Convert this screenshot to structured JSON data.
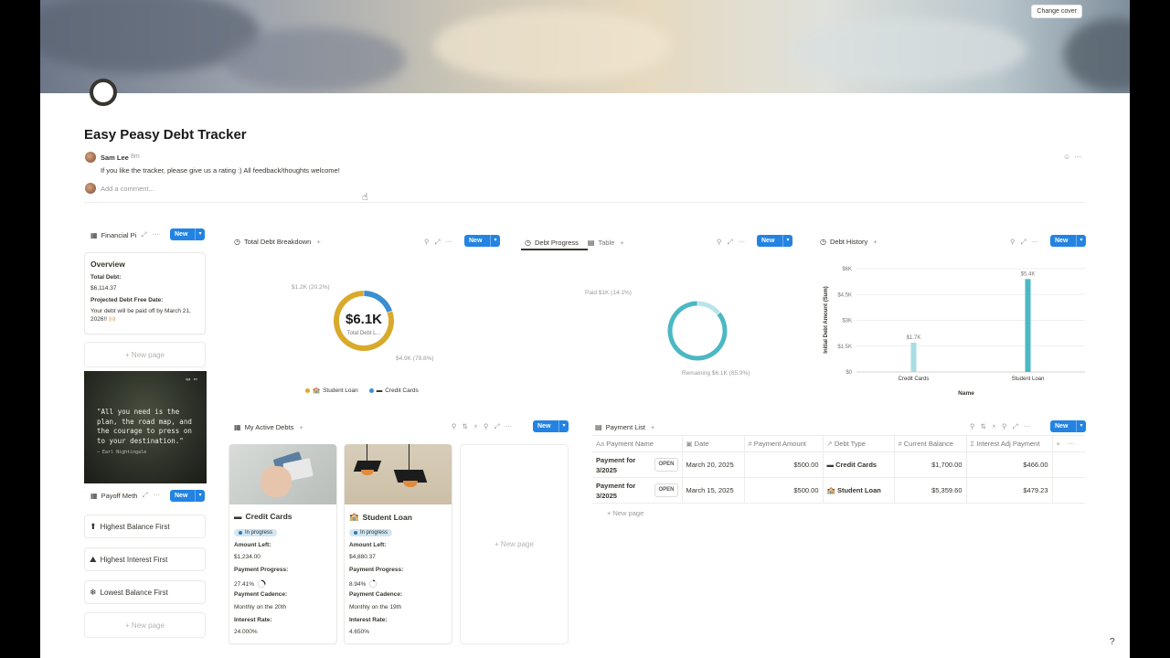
{
  "cover": {
    "change_label": "Change cover"
  },
  "page": {
    "title": "Easy Peasy Debt Tracker"
  },
  "comment": {
    "author": "Sam Lee",
    "time": "8m",
    "text": "If you like the tracker, please give us a rating :) All feedback/thoughts welcome!",
    "add_placeholder": "Add a comment..."
  },
  "financial": {
    "view_label": "Financial Pi",
    "new_label": "New",
    "overview_title": "Overview",
    "total_debt_label": "Total Debt:",
    "total_debt_value": "$6,114.37",
    "free_date_label": "Projected Debt Free Date:",
    "free_date_text": "Your debt will be paid off by March 21, 2026!! 🙌🏻",
    "new_page": "+ New page"
  },
  "quote": {
    "text": "\"All you need is the plan, the road map, and the courage to press on to your destination.\"",
    "author": "— Earl Nightingale"
  },
  "payoff": {
    "view_label": "Payoff Meth",
    "new_label": "New",
    "methods": [
      {
        "icon": "arrow-up-circle-icon",
        "glyph": "⬆",
        "label": "Highest Balance First"
      },
      {
        "icon": "mountain-icon",
        "glyph": "⛰",
        "label": "Highest Interest First"
      },
      {
        "icon": "snowflake-icon",
        "glyph": "❄",
        "label": "Lowest Balance First"
      }
    ],
    "new_page": "+ New page"
  },
  "breakdown": {
    "view_label": "Total Debt Breakdown",
    "new_label": "New",
    "center_value": "$6.1K",
    "center_label": "Total Debt L...",
    "legend": [
      "Student Loan",
      "Credit Cards"
    ],
    "colors": {
      "student_loan": "#d9a92a",
      "credit_cards": "#3b8ed0"
    }
  },
  "progress": {
    "tab_active": "Debt Progress",
    "tab_other": "Table",
    "new_label": "New",
    "colors": {
      "paid": "#b9e4e9",
      "remaining": "#4bb8c4"
    }
  },
  "history": {
    "view_label": "Debt History",
    "new_label": "New",
    "bar_color": "#4bb8c4"
  },
  "chart_data": [
    {
      "type": "pie",
      "title": "Total Debt Breakdown",
      "categories": [
        "Credit Cards",
        "Student Loan"
      ],
      "values": [
        1200,
        4900
      ],
      "labels": [
        "$1.2K (20.2%)",
        "$4.9K (79.8%)"
      ]
    },
    {
      "type": "pie",
      "title": "Debt Progress",
      "categories": [
        "Paid",
        "Remaining"
      ],
      "values": [
        1000,
        6100
      ],
      "labels": [
        "Paid $1K (14.1%)",
        "Remaining $6.1K (85.9%)"
      ]
    },
    {
      "type": "bar",
      "title": "Debt History",
      "categories": [
        "Credit Cards",
        "Student Loan"
      ],
      "values": [
        1700,
        5400
      ],
      "labels": [
        "$1.7K",
        "$5.4K"
      ],
      "xlabel": "Name",
      "ylabel": "Initial Debt Amount (Sum)",
      "ylim": [
        0,
        6000
      ],
      "ticks": [
        "$0",
        "$1.5K",
        "$3K",
        "$4.5K",
        "$6K"
      ],
      "grid": true
    }
  ],
  "active_debts": {
    "view_label": "My Active Debts",
    "new_label": "New",
    "cards": [
      {
        "title": "Credit Cards",
        "status": "In progress",
        "amount_label": "Amount Left:",
        "amount": "$1,234.00",
        "progress_label": "Payment Progress:",
        "progress": "27.41%",
        "progress_frac": 0.2741,
        "cadence_label": "Payment Cadence:",
        "cadence": "Monthly on the 20th",
        "rate_label": "Interest Rate:",
        "rate": "24.000%"
      },
      {
        "title": "Student Loan",
        "status": "In progress",
        "amount_label": "Amount Left:",
        "amount": "$4,880.37",
        "progress_label": "Payment Progress:",
        "progress": "8.94%",
        "progress_frac": 0.0894,
        "cadence_label": "Payment Cadence:",
        "cadence": "Monthly on the 19th",
        "rate_label": "Interest Rate:",
        "rate": "4.650%"
      }
    ],
    "new_page": "+ New page"
  },
  "payments": {
    "view_label": "Payment List",
    "new_label": "New",
    "headers": [
      "Payment Name",
      "Date",
      "Payment Amount",
      "Debt Type",
      "Current Balance",
      "Interest Adj Payment"
    ],
    "open_label": "OPEN",
    "rows": [
      {
        "name": "Payment for 3/2025",
        "date": "March 20, 2025",
        "amount": "$500.00",
        "type": "Credit Cards",
        "balance": "$1,700.00",
        "adj": "$466.00"
      },
      {
        "name": "Payment for 3/2025",
        "date": "March 15, 2025",
        "amount": "$500.00",
        "type": "Student Loan",
        "balance": "$5,359.60",
        "adj": "$479.23"
      }
    ],
    "new_page": "+ New page"
  }
}
